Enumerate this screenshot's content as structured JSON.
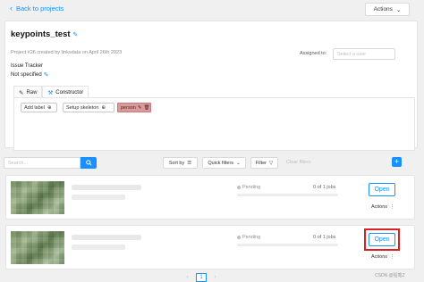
{
  "header": {
    "back_label": "Back to projects",
    "actions_label": "Actions"
  },
  "project": {
    "title": "keypoints_test",
    "meta": "Project #26 created by linksdata on April 26th 2023",
    "assigned_label": "Assigned to:",
    "assignee_placeholder": "Select a user",
    "issue_tracker_label": "Issue Tracker",
    "issue_tracker_value": "Not specified"
  },
  "label_tabs": {
    "raw": "Raw",
    "constructor": "Constructor"
  },
  "label_editor": {
    "add_label": "Add label",
    "setup_skeleton": "Setup skeleton",
    "labels": [
      "person"
    ]
  },
  "task_toolbar": {
    "search_placeholder": "Search...",
    "sort_by": "Sort by",
    "quick_filters": "Quick filters",
    "filter": "Filter",
    "clear_filters": "Clear filters"
  },
  "tasks": [
    {
      "status": "Pending",
      "jobs": "0 of 1 jobs",
      "progress": 0,
      "open_label": "Open",
      "actions_label": "Actions"
    },
    {
      "status": "Pending",
      "jobs": "0 of 1 jobs",
      "progress": 0,
      "open_label": "Open",
      "actions_label": "Actions"
    }
  ],
  "pagination": {
    "current_page": "1"
  },
  "watermark": "CSDN @铅笔Z",
  "colors": {
    "accent": "#1890ff",
    "label_person": "#d79b9b",
    "highlight": "#e02020"
  }
}
